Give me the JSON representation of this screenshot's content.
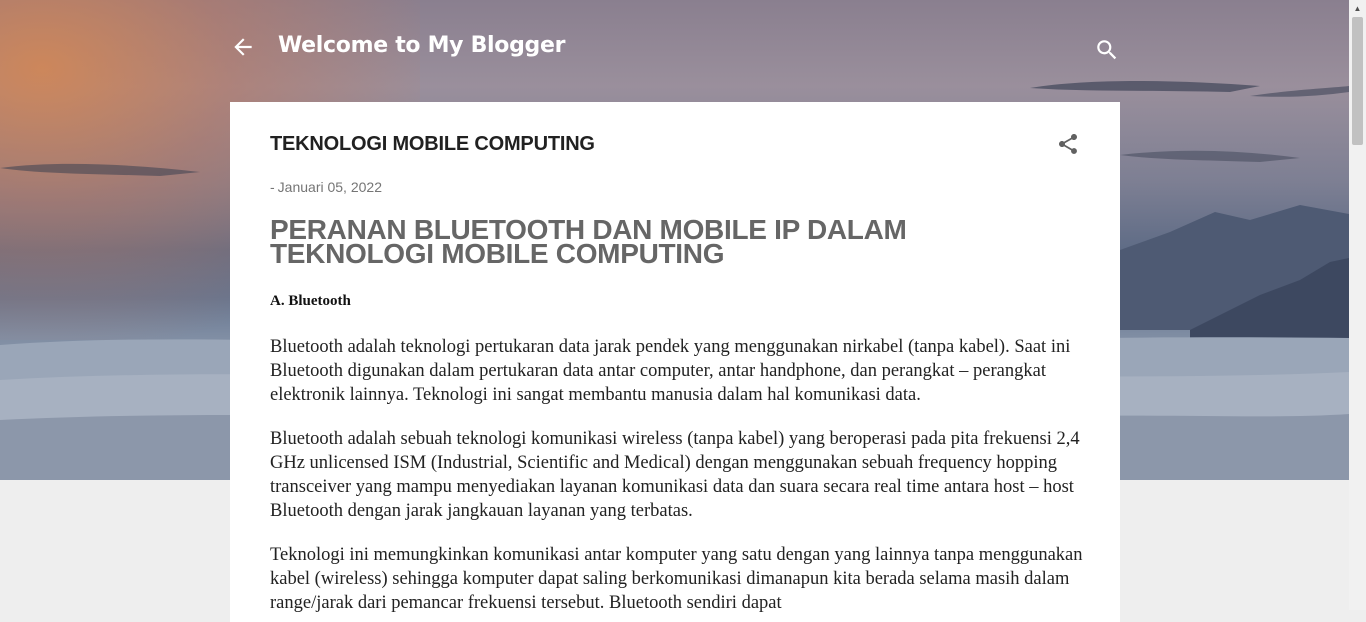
{
  "header": {
    "back_icon": "arrow-left-icon",
    "title": "Welcome to My Blogger",
    "search_icon": "search-icon"
  },
  "post": {
    "title": "TEKNOLOGI MOBILE COMPUTING",
    "share_icon": "share-icon",
    "date_prefix": "-",
    "date": "Januari 05, 2022",
    "heading": "PERANAN BLUETOOTH DAN MOBILE IP DALAM TEKNOLOGI MOBILE COMPUTING",
    "subheading": "A. Bluetooth",
    "paragraphs": [
      "Bluetooth adalah teknologi pertukaran data jarak pendek yang menggunakan nirkabel (tanpa kabel). Saat ini Bluetooth digunakan dalam pertukaran data antar computer, antar handphone, dan perangkat – perangkat elektronik lainnya. Teknologi ini sangat membantu manusia dalam hal komunikasi data.",
      "Bluetooth adalah sebuah teknologi komunikasi wireless (tanpa kabel) yang beroperasi pada pita frekuensi 2,4 GHz unlicensed ISM (Industrial, Scientific and Medical) dengan menggunakan sebuah frequency hopping transceiver yang mampu menyediakan layanan komunikasi data dan suara secara real time antara host – host Bluetooth dengan jarak jangkauan layanan yang terbatas.",
      "Teknologi ini memungkinkan komunikasi antar komputer yang satu dengan yang lainnya tanpa menggunakan kabel (wireless) sehingga komputer dapat saling berkomunikasi dimanapun kita berada selama masih dalam range/jarak dari pemancar frekuensi tersebut. Bluetooth sendiri dapat"
    ]
  },
  "colors": {
    "card": "#ffffff",
    "page_background": "#eeeeee",
    "header_text": "#ffffff",
    "heading_text": "#666666"
  }
}
